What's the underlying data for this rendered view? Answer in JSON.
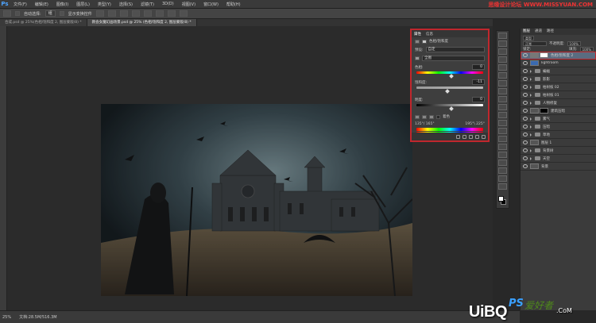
{
  "app": {
    "logo": "Ps",
    "menus": [
      "文件(F)",
      "编辑(E)",
      "图像(I)",
      "图层(L)",
      "类型(Y)",
      "选择(S)",
      "滤镜(T)",
      "3D(D)",
      "视图(V)",
      "窗口(W)",
      "帮助(H)"
    ],
    "top_watermark": "思缘设计论坛 WWW.MISSYUAN.COM"
  },
  "options": {
    "auto_select_label": "自动选择:",
    "auto_select_value": "组",
    "show_transform_label": "显示变换控件"
  },
  "tabs": [
    {
      "label": "合成.psd @ 25%(色相/饱和度 2, 图层蒙版/8) *",
      "active": false
    },
    {
      "label": "教会女魔幻画场景.psd @ 25% (色相/饱和度 2, 图层蒙版/8) *",
      "active": true
    }
  ],
  "properties": {
    "tabs": [
      "属性",
      "信息"
    ],
    "title": "色相/饱和度",
    "preset_label": "预设:",
    "preset_value": "自定",
    "channel_value": "全图",
    "hue_label": "色相:",
    "hue_value": "0",
    "saturation_label": "饱和度:",
    "saturation_value": "-11",
    "lightness_label": "明度:",
    "lightness_value": "0",
    "colorize_label": "着色",
    "range_left": "135°/ 165°",
    "range_right": "195°\\ 225°"
  },
  "layers": {
    "tabs": [
      "图层",
      "通道",
      "路径"
    ],
    "kind_label": "类型",
    "blend_mode": "正常",
    "opacity_label": "不透明度:",
    "opacity_value": "100%",
    "lock_label": "锁定:",
    "fill_label": "填充:",
    "fill_value": "100%",
    "items": [
      {
        "name": "色相/饱和度 2",
        "type": "adjustment",
        "selected": true
      },
      {
        "name": "lightroom",
        "type": "layer-blue",
        "selected": false
      },
      {
        "name": "蝙蝠",
        "type": "folder",
        "selected": false
      },
      {
        "name": "影影",
        "type": "folder",
        "selected": false
      },
      {
        "name": "枯树枝 02",
        "type": "folder",
        "selected": false
      },
      {
        "name": "枯树枝 01",
        "type": "folder",
        "selected": false
      },
      {
        "name": "人物修复",
        "type": "folder",
        "selected": false
      },
      {
        "name": "建筑压暗",
        "type": "mask-black",
        "selected": false
      },
      {
        "name": "雾气",
        "type": "folder",
        "selected": false
      },
      {
        "name": "压暗",
        "type": "folder",
        "selected": false
      },
      {
        "name": "草地",
        "type": "folder",
        "selected": false
      },
      {
        "name": "图层 1",
        "type": "layer",
        "selected": false
      },
      {
        "name": "背景树",
        "type": "folder",
        "selected": false
      },
      {
        "name": "天空",
        "type": "folder",
        "selected": false
      },
      {
        "name": "背景",
        "type": "layer",
        "selected": false
      }
    ]
  },
  "status": {
    "zoom": "25%",
    "doc_size": "文档:28.5M/516.3M"
  },
  "watermark": {
    "brand": "UiBQ",
    "ps": "PS",
    "cn": "爱好者",
    "com": ".CoM"
  }
}
